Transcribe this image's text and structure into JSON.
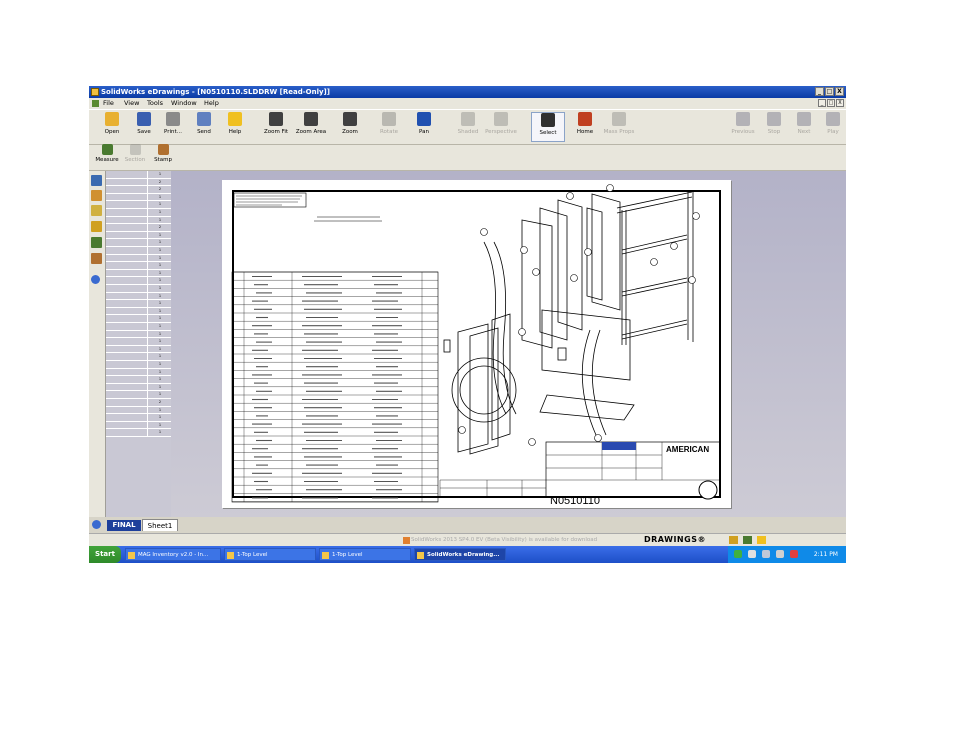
{
  "window": {
    "title": "SolidWorks eDrawings - [N0510110.SLDDRW [Read-Only]]",
    "controls": [
      "_",
      "□",
      "X"
    ]
  },
  "menu": [
    "File",
    "View",
    "Tools",
    "Window",
    "Help"
  ],
  "toolbar": {
    "buttons": [
      {
        "label": "Open",
        "icon": "open-folder-icon",
        "color": "#e8b030",
        "enabled": true
      },
      {
        "label": "Save",
        "icon": "save-icon",
        "color": "#3a5fb0",
        "enabled": true
      },
      {
        "label": "Print...",
        "icon": "print-icon",
        "color": "#8a8a8a",
        "enabled": true
      },
      {
        "label": "Send",
        "icon": "send-icon",
        "color": "#6080c0",
        "enabled": true
      },
      {
        "label": "Help",
        "icon": "help-icon",
        "color": "#f0c020",
        "enabled": true
      },
      {
        "label": "Zoom Fit",
        "icon": "zoom-fit-icon",
        "color": "#404040",
        "enabled": true
      },
      {
        "label": "Zoom Area",
        "icon": "zoom-area-icon",
        "color": "#404040",
        "enabled": true
      },
      {
        "label": "Zoom",
        "icon": "zoom-icon",
        "color": "#404040",
        "enabled": true
      },
      {
        "label": "Rotate",
        "icon": "rotate-icon",
        "color": "#606060",
        "enabled": false
      },
      {
        "label": "Pan",
        "icon": "pan-icon",
        "color": "#2050b0",
        "enabled": true
      },
      {
        "label": "Shaded",
        "icon": "shaded-icon",
        "color": "#707070",
        "enabled": false
      },
      {
        "label": "Perspective",
        "icon": "perspective-icon",
        "color": "#707070",
        "enabled": false
      },
      {
        "label": "Select",
        "icon": "select-arrow-icon",
        "color": "#303030",
        "enabled": true
      },
      {
        "label": "Home",
        "icon": "home-icon",
        "color": "#c04020",
        "enabled": true
      },
      {
        "label": "Mass Props",
        "icon": "mass-props-icon",
        "color": "#707070",
        "enabled": false
      },
      {
        "label": "Previous",
        "icon": "previous-icon",
        "color": "#505070",
        "enabled": false
      },
      {
        "label": "Stop",
        "icon": "stop-icon",
        "color": "#505070",
        "enabled": false
      },
      {
        "label": "Next",
        "icon": "next-icon",
        "color": "#505070",
        "enabled": false
      },
      {
        "label": "Play",
        "icon": "play-icon",
        "color": "#505070",
        "enabled": false
      }
    ],
    "row2": [
      {
        "label": "Measure",
        "icon": "measure-icon",
        "color": "#4a7a30",
        "enabled": true
      },
      {
        "label": "Section",
        "icon": "section-icon",
        "color": "#808080",
        "enabled": false
      },
      {
        "label": "Stamp",
        "icon": "stamp-icon",
        "color": "#b07030",
        "enabled": true
      }
    ]
  },
  "bom_panel": {
    "qty": [
      "1",
      "2",
      "2",
      "1",
      "1",
      "1",
      "1",
      "2",
      "1",
      "1",
      "1",
      "1",
      "1",
      "1",
      "1",
      "1",
      "1",
      "1",
      "1",
      "1",
      "1",
      "1",
      "1",
      "1",
      "1",
      "1",
      "1",
      "1",
      "1",
      "1",
      "2",
      "1",
      "1",
      "1",
      "1"
    ],
    "name": [
      "",
      "",
      "",
      "",
      "",
      "",
      "",
      "",
      "",
      "",
      "",
      "",
      "",
      "",
      "",
      "",
      "",
      "",
      "",
      "",
      "",
      "",
      "",
      "",
      "",
      "",
      "",
      "",
      "",
      "",
      "",
      "",
      "",
      "",
      ""
    ]
  },
  "drawing": {
    "number": "N0510110",
    "company": "AMERICAN"
  },
  "tabs": {
    "active": "FINAL",
    "other": "Sheet1"
  },
  "status": {
    "message": "SolidWorks 2013 SP4.0 EV (Beta Visibility) is available for download",
    "brand": "DRAWINGS®"
  },
  "taskbar": {
    "start": "Start",
    "tasks": [
      "MAG Inventory v2.0 - In...",
      "1-Top Level",
      "1-Top Level",
      "SolidWorks eDrawing..."
    ],
    "clock": "2:11 PM"
  },
  "colors": {
    "titlebar": "#0a3aa5",
    "taskbar": "#1d4fc8",
    "start": "#2e8a2a",
    "tab_active": "#1d3f9b",
    "workspace": "#bcbbcd"
  }
}
